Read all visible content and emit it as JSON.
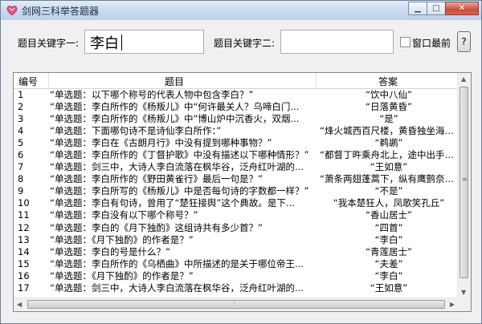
{
  "window": {
    "title": "剑网三科举答题器"
  },
  "search": {
    "label1": "题目关键字一:",
    "value1": "李白",
    "label2": "题目关键字二:",
    "value2": "",
    "checkbox_label": "窗口最前",
    "help_label": "?"
  },
  "table": {
    "columns": [
      "编号",
      "题目",
      "答案"
    ],
    "rows": [
      [
        "1",
        "“单选题：以下哪个称号的代表人物中包含李白？”",
        "“饮中八仙”"
      ],
      [
        "2",
        "“单选题：李白所作的《杨叛儿》中“何许最关人？乌啼白门...",
        "“日落黄昏”"
      ],
      [
        "3",
        "“单选题：李白所作的《杨叛儿》中”博山炉中沉香火，双烟...",
        "“是”"
      ],
      [
        "4",
        "“单选题：下面哪句诗不是诗仙李白所作：”",
        "“烽火城西百尺楼，黄昏独坐海风..."
      ],
      [
        "5",
        "“单选题：李白在《古朗月行》中没有提到哪种事物？”",
        "“鹈鹕”"
      ],
      [
        "6",
        "“单选题：李白所作的《丁督护歌》中没有描述以下哪种情形？”",
        "“都督丁旿乘舟北上，途中出手痛..."
      ],
      [
        "7",
        "“单选题：剑三中，大诗人李白流落在枫华谷，泛舟红叶湖的...",
        "“王如意”"
      ],
      [
        "8",
        "“单选题：李白所作的《野田黄雀行》最后一句是？”",
        "“萧条两翅蓬蒿下，纵有鹰鹯奈若..."
      ],
      [
        "9",
        "“单选题：李白所写的《杨叛儿》中是否每句诗的字数都一样？”",
        "“不是”"
      ],
      [
        "10",
        "“单选题：李白有句诗，曾用了“楚狂接舆”这个典故。是下...",
        "“我本楚狂人，凤歌笑孔丘”"
      ],
      [
        "11",
        "“单选题：李白没有以下哪个称号？”",
        "“香山居士”"
      ],
      [
        "12",
        "“单选题：李白的《月下独酌》这组诗共有多少首？”",
        "“四首”"
      ],
      [
        "13",
        "“单选题：《月下独酌》的作者是？”",
        "“李白”"
      ],
      [
        "14",
        "“单选题：李白的号是什么？”",
        "“青莲居士”"
      ],
      [
        "15",
        "“单选题：李白所作的《乌栖曲》中所描述的是关于哪位帝王...",
        "“夫差”"
      ],
      [
        "16",
        "“单选题：《月下独酌》的作者是？”",
        "“李白”"
      ],
      [
        "17",
        "“单选题：剑三中，大诗人李白流落在枫华谷，泛舟红叶湖的...",
        "“王如意”"
      ]
    ]
  }
}
